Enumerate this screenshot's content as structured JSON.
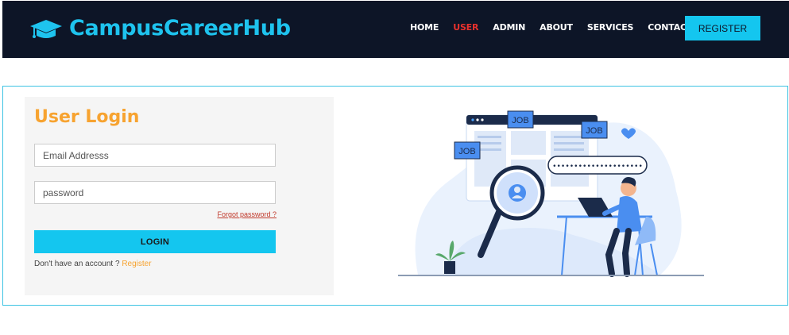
{
  "brand": {
    "name": "CampusCareerHub",
    "icon": "graduation-cap-icon",
    "color": "#1ec3ee"
  },
  "nav": {
    "links": [
      {
        "label": "HOME",
        "active": false
      },
      {
        "label": "USER",
        "active": true
      },
      {
        "label": "ADMIN",
        "active": false
      },
      {
        "label": "ABOUT",
        "active": false
      },
      {
        "label": "SERVICES",
        "active": false
      },
      {
        "label": "CONTACT",
        "active": false
      }
    ],
    "register_label": "REGISTER"
  },
  "login": {
    "title": "User Login",
    "email_placeholder": "Email Addresss",
    "password_placeholder": "password",
    "forgot_label": "Forgot password ?",
    "submit_label": "LOGIN",
    "signup_prompt": "Don't have an account ?",
    "signup_link": "Register"
  },
  "illustration": {
    "job_tags": [
      "JOB",
      "JOB",
      "JOB"
    ]
  },
  "colors": {
    "accent": "#14c6ef",
    "title": "#f7a330",
    "nav_bg": "#0d1527",
    "active_nav": "#e8312d"
  }
}
